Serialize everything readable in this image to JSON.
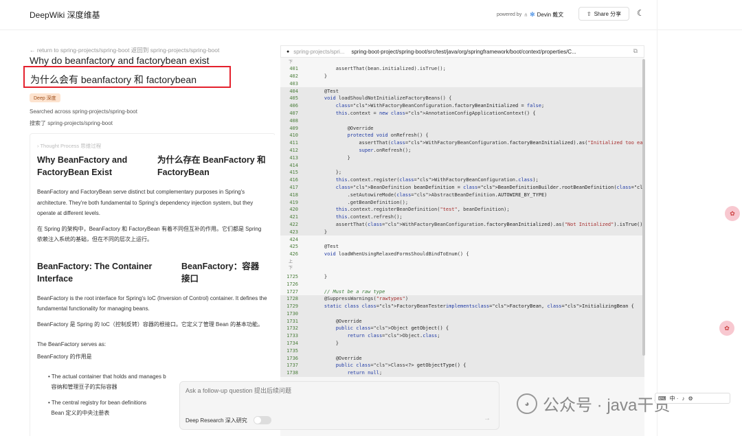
{
  "header": {
    "app_title": "DeepWiki 深度维基",
    "powered_by": "powered by",
    "devin_label": "Devin 戴文",
    "share_label": "Share 分享"
  },
  "left": {
    "back_link": "← return to spring-projects/spring-boot 返回到 spring-projects/spring-boot",
    "question_en": "Why do beanfactory and factorybean exist",
    "question_cn": "为什么会有 beanfactory 和 factorybean",
    "badge": "Deep 深度",
    "searched_en": "Searched across spring-projects/spring-boot",
    "searched_cn": "搜索了 spring-projects/spring-boot",
    "thought": "Thought Process 思维过程",
    "h1_en": "Why BeanFactory and FactoryBean Exist",
    "h1_cn": "为什么存在 BeanFactory 和 FactoryBean",
    "p1_en": "BeanFactory and FactoryBean serve distinct but complementary purposes in Spring's architecture. They're both fundamental to Spring's dependency injection system, but they operate at different levels.",
    "p1_cn": "在 Spring 的架构中，BeanFactory 和 FactoryBean 有着不同但互补的作用。它们都是 Spring 依赖注入系统的基础，但在不同的层次上运行。",
    "h2_en": "BeanFactory: The Container Interface",
    "h2_cn": "BeanFactory：容器接口",
    "p2_en": "BeanFactory is the root interface for Spring's IoC (Inversion of Control) container. It defines the fundamental functionality for managing beans.",
    "p2_cn": "BeanFactory 是 Spring 的 IoC（控制反转）容器的根接口。它定义了管理 Bean 的基本功能。",
    "p3_en": "The BeanFactory serves as:",
    "p3_cn": "BeanFactory 的作用是",
    "list": [
      {
        "en": "The actual container that holds and manages b",
        "cn": "容纳和管理豆子的实际容器"
      },
      {
        "en": "The central registry for bean definitions",
        "cn": "Bean 定义的中央注册表"
      }
    ]
  },
  "code": {
    "crumb": "spring-projects/spri...",
    "path": "spring-boot-project/spring-boot/src/test/java/org/springframework/boot/context/properties/C...",
    "collapse_top": "下",
    "collapse_mid": "上\n下"
  },
  "followup": {
    "placeholder": "Ask a follow-up question 提出后续问题",
    "deep_label": "Deep Research 深入研究"
  },
  "watermark": {
    "text": "公众号 · java干货"
  },
  "toolbar": {
    "label": "中 ·"
  }
}
